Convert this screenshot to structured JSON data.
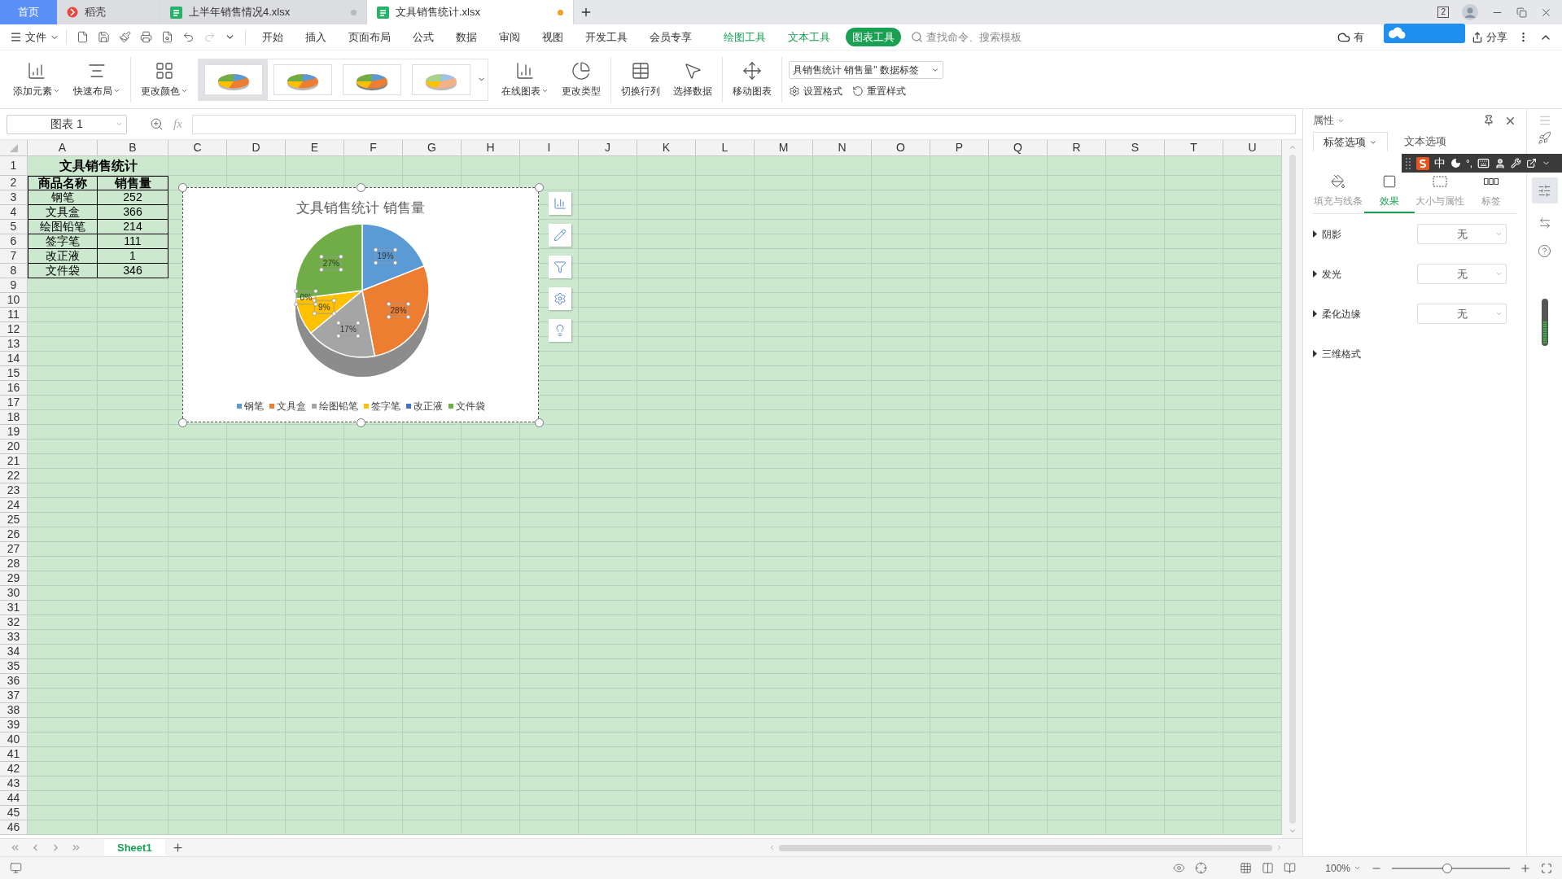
{
  "tabs": [
    {
      "label": "首页",
      "kind": "home",
      "selected": false
    },
    {
      "label": "稻壳",
      "kind": "docer",
      "selected": false
    },
    {
      "label": "上半年销售情况4.xlsx",
      "kind": "sheet",
      "selected": false,
      "modified": false
    },
    {
      "label": "文具销售统计.xlsx",
      "kind": "sheet",
      "selected": true,
      "modified": true
    }
  ],
  "title_bar": {
    "window_count": "2"
  },
  "menu": {
    "file": "文件",
    "items": [
      {
        "label": "开始",
        "kind": "main",
        "selected": false
      },
      {
        "label": "插入",
        "kind": "main",
        "selected": false
      },
      {
        "label": "页面布局",
        "kind": "main",
        "selected": false
      },
      {
        "label": "公式",
        "kind": "main",
        "selected": false
      },
      {
        "label": "数据",
        "kind": "main",
        "selected": false
      },
      {
        "label": "审阅",
        "kind": "main",
        "selected": false
      },
      {
        "label": "视图",
        "kind": "main",
        "selected": false
      },
      {
        "label": "开发工具",
        "kind": "main",
        "selected": false
      },
      {
        "label": "会员专享",
        "kind": "main",
        "selected": false
      },
      {
        "label": "绘图工具",
        "kind": "context",
        "selected": false
      },
      {
        "label": "文本工具",
        "kind": "context",
        "selected": false
      },
      {
        "label": "图表工具",
        "kind": "context",
        "selected": true
      }
    ],
    "search_placeholder": "查找命令、搜索模板",
    "cloud_text": "有",
    "share": "分享"
  },
  "ribbon": {
    "element_buttons": [
      {
        "label": "添加元素",
        "kind": "add_element",
        "dropdown": true
      },
      {
        "label": "快速布局",
        "kind": "quick_layout",
        "dropdown": true
      }
    ],
    "color_button": {
      "label": "更改颜色",
      "kind": "change_color",
      "dropdown": true
    },
    "styles": [
      {
        "selected": true
      },
      {
        "selected": false
      },
      {
        "selected": false
      },
      {
        "selected": false
      }
    ],
    "type_buttons": [
      {
        "label": "在线图表",
        "kind": "online_chart",
        "dropdown": true
      },
      {
        "label": "更改类型",
        "kind": "change_type",
        "dropdown": false
      }
    ],
    "data_buttons": [
      {
        "label": "切换行列",
        "kind": "switch_row_col",
        "dropdown": false
      },
      {
        "label": "选择数据",
        "kind": "select_data",
        "dropdown": false
      }
    ],
    "move_button": {
      "label": "移动图表",
      "kind": "move_chart",
      "dropdown": false
    },
    "element_selector": "具销售统计 销售量\" 数据标签",
    "format_buttons": [
      {
        "label": "设置格式",
        "kind": "format"
      },
      {
        "label": "重置样式",
        "kind": "reset"
      }
    ]
  },
  "formula_bar": {
    "name_box": "图表 1",
    "fx": "fx"
  },
  "sheet": {
    "columns": [
      "A",
      "B",
      "C",
      "D",
      "E",
      "F",
      "G",
      "H",
      "I",
      "J",
      "K",
      "L",
      "M",
      "N",
      "O",
      "P",
      "Q",
      "R",
      "S",
      "T",
      "U"
    ],
    "rows": [
      "1",
      "2",
      "3",
      "4",
      "5",
      "6",
      "7",
      "8",
      "9",
      "10",
      "11",
      "12",
      "13",
      "14",
      "15",
      "16",
      "17",
      "18",
      "19",
      "20",
      "21",
      "22",
      "23",
      "24",
      "25",
      "26",
      "27",
      "28",
      "29",
      "30",
      "31",
      "32",
      "33",
      "34",
      "35",
      "36",
      "37",
      "38",
      "39",
      "40",
      "41",
      "42",
      "43",
      "44",
      "45",
      "46"
    ],
    "title": "文具销售统计",
    "header": [
      "商品名称",
      "销售量"
    ],
    "records": [
      [
        "钢笔",
        "252"
      ],
      [
        "文具盒",
        "366"
      ],
      [
        "绘图铅笔",
        "214"
      ],
      [
        "签字笔",
        "111"
      ],
      [
        "改正液",
        "1"
      ],
      [
        "文件袋",
        "346"
      ]
    ]
  },
  "chart": {
    "chart_data": {
      "type": "pie",
      "title": "文具销售统计 销售量",
      "categories": [
        "钢笔",
        "文具盒",
        "绘图铅笔",
        "签字笔",
        "改正液",
        "文件袋"
      ],
      "values": [
        19,
        28,
        17,
        9,
        0,
        27
      ],
      "data_labels": true,
      "value_labels": [
        "19%",
        "28%",
        "17%",
        "9%",
        "0%",
        "27%"
      ],
      "legend": "bottom"
    },
    "slices": [
      {
        "color": "#5b9bd5"
      },
      {
        "color": "#ed7d31"
      },
      {
        "color": "#a5a5a5"
      },
      {
        "color": "#ffc000"
      },
      {
        "color": "#4472c4"
      },
      {
        "color": "#70ad47"
      }
    ]
  },
  "panel": {
    "title": "属性",
    "tabs": [
      {
        "label": "标签选项",
        "selected": true,
        "dropdown": true
      },
      {
        "label": "文本选项",
        "selected": false,
        "dropdown": false
      }
    ],
    "subtabs": [
      {
        "label": "填充与线条",
        "kind": "fill",
        "selected": false
      },
      {
        "label": "效果",
        "kind": "effect",
        "selected": true
      },
      {
        "label": "大小与属性",
        "kind": "size",
        "selected": false
      },
      {
        "label": "标签",
        "kind": "label",
        "selected": false
      }
    ],
    "sections": [
      {
        "label": "阴影",
        "kind": "dropdown",
        "value": "无"
      },
      {
        "label": "发光",
        "kind": "dropdown",
        "value": "无"
      },
      {
        "label": "柔化边缘",
        "kind": "dropdown",
        "value": "无"
      },
      {
        "label": "三维格式",
        "kind": "plain"
      }
    ]
  },
  "ime": {
    "mode": "中",
    "punct": "°,"
  },
  "sheet_tabs": [
    {
      "label": "Sheet1",
      "selected": true
    }
  ],
  "status_bar": {
    "zoom": "100%",
    "level": 0.47
  }
}
